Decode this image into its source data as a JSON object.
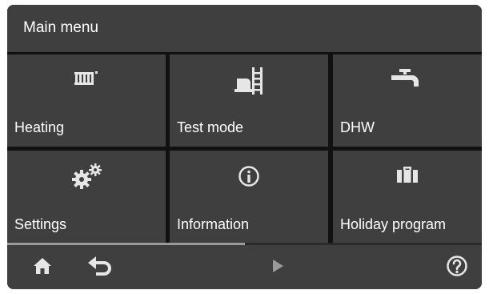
{
  "header": {
    "title": "Main menu"
  },
  "tiles": [
    {
      "label": "Heating",
      "icon": "radiator-icon"
    },
    {
      "label": "Test mode",
      "icon": "chimney-sweep-icon"
    },
    {
      "label": "DHW",
      "icon": "tap-icon"
    },
    {
      "label": "Settings",
      "icon": "gears-icon"
    },
    {
      "label": "Information",
      "icon": "info-icon"
    },
    {
      "label": "Holiday program",
      "icon": "suitcase-icon"
    }
  ],
  "page_progress": 0.5,
  "bottom_bar": {
    "home_icon": "home-icon",
    "back_icon": "back-arrow-icon",
    "next_icon": "play-next-icon",
    "help_icon": "help-icon"
  },
  "colors": {
    "tile": "#3f3f3f",
    "background": "#111111",
    "icon": "#e6e6e6",
    "progress": "#9a9a9a"
  }
}
